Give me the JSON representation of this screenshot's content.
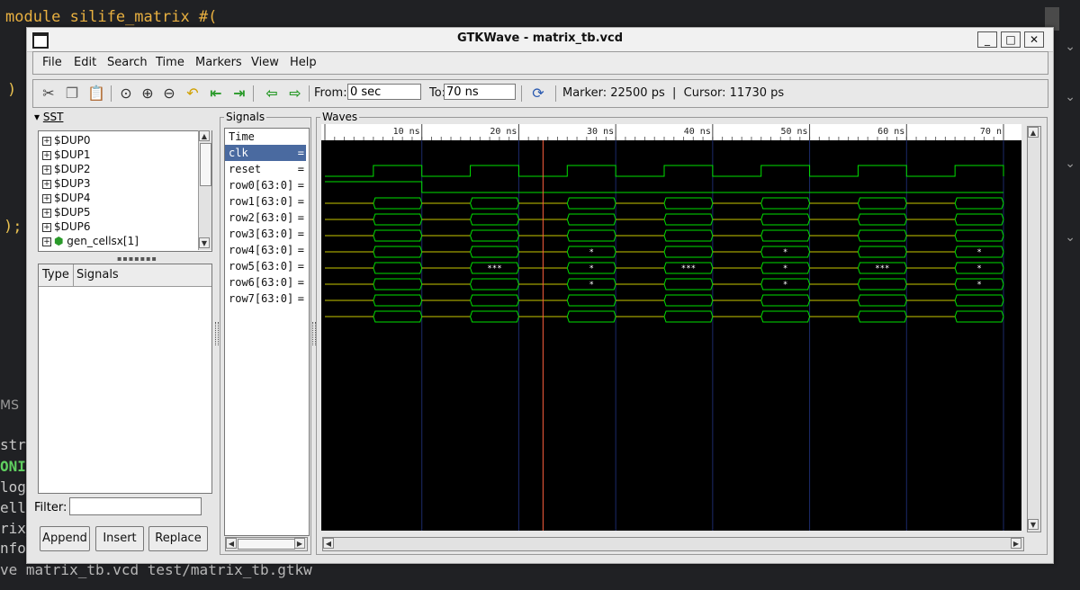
{
  "editor": {
    "code_line": "module silife_matrix #(",
    "paren_close": ")",
    "paren_semicolon": ");",
    "side_tab": "MS",
    "fragments": [
      "str",
      "ONI",
      "log",
      "ell",
      "rix_",
      "nfo"
    ],
    "command": "ve matrix_tb.vcd test/matrix_tb.gtkw"
  },
  "window": {
    "title": "GTKWave - matrix_tb.vcd",
    "minimize": "_",
    "maximize": "□",
    "close": "✕"
  },
  "menu": [
    "File",
    "Edit",
    "Search",
    "Time",
    "Markers",
    "View",
    "Help"
  ],
  "toolbar": {
    "from_label": "From:",
    "from_value": "0 sec",
    "to_label": "To:",
    "to_value": "70 ns",
    "marker_text": "Marker: 22500 ps  |  Cursor: 11730 ps",
    "icons": [
      "cut-icon",
      "copy-icon",
      "paste-icon",
      "zoom-fit-icon",
      "zoom-in-icon",
      "zoom-out-icon",
      "undo-zoom-icon",
      "zoom-to-start-icon",
      "zoom-to-end-icon",
      "prev-edge-icon",
      "next-edge-icon",
      "reload-icon"
    ]
  },
  "sst": {
    "header": "SST",
    "tree": [
      "$DUP0",
      "$DUP1",
      "$DUP2",
      "$DUP3",
      "$DUP4",
      "$DUP5",
      "$DUP6",
      "gen_cellsx[1]"
    ],
    "columns": {
      "type": "Type",
      "signals": "Signals"
    },
    "filter_label": "Filter:",
    "filter_value": "",
    "buttons": {
      "append": "Append",
      "insert": "Insert",
      "replace": "Replace"
    }
  },
  "signals": {
    "header": "Signals",
    "rows": [
      {
        "name": "Time",
        "eq": ""
      },
      {
        "name": "clk",
        "eq": "=",
        "selected": true
      },
      {
        "name": "reset",
        "eq": "="
      },
      {
        "name": "row0[63:0]",
        "eq": "="
      },
      {
        "name": "row1[63:0]",
        "eq": "="
      },
      {
        "name": "row2[63:0]",
        "eq": "="
      },
      {
        "name": "row3[63:0]",
        "eq": "="
      },
      {
        "name": "row4[63:0]",
        "eq": "="
      },
      {
        "name": "row5[63:0]",
        "eq": "="
      },
      {
        "name": "row6[63:0]",
        "eq": "="
      },
      {
        "name": "row7[63:0]",
        "eq": "="
      }
    ]
  },
  "waves": {
    "header": "Waves",
    "time_start_ns": 0,
    "time_end_ns": 70,
    "ticks": [
      "10 ns",
      "20 ns",
      "30 ns",
      "40 ns",
      "50 ns",
      "60 ns",
      "70 n"
    ],
    "tick_values_ns": [
      10,
      20,
      30,
      40,
      50,
      60,
      70
    ],
    "marker_ns": 22.5,
    "clk_period_ns": 10,
    "clk_high_start_ns": 5,
    "reset_release_ns": 10,
    "bus_changes_ns": [
      5,
      10,
      15,
      20,
      25,
      30,
      35,
      40,
      45,
      50,
      55,
      60,
      65,
      70
    ],
    "annotations": [
      {
        "row": "row3",
        "items": [
          {
            "t": 27.5,
            "label": "*"
          },
          {
            "t": 47.5,
            "label": "*"
          },
          {
            "t": 67.5,
            "label": "*"
          }
        ]
      },
      {
        "row": "row4",
        "items": [
          {
            "t": 17.5,
            "label": "***"
          },
          {
            "t": 27.5,
            "label": "*"
          },
          {
            "t": 37.5,
            "label": "***"
          },
          {
            "t": 47.5,
            "label": "*"
          },
          {
            "t": 57.5,
            "label": "***"
          },
          {
            "t": 67.5,
            "label": "*"
          }
        ]
      },
      {
        "row": "row5",
        "items": [
          {
            "t": 27.5,
            "label": "*"
          },
          {
            "t": 47.5,
            "label": "*"
          },
          {
            "t": 67.5,
            "label": "*"
          }
        ]
      }
    ],
    "colors": {
      "background": "#000000",
      "signal": "#00e000",
      "bus_idle": "#c8c800",
      "marker": "#ff6040",
      "grid": "#1b2a6a"
    }
  }
}
